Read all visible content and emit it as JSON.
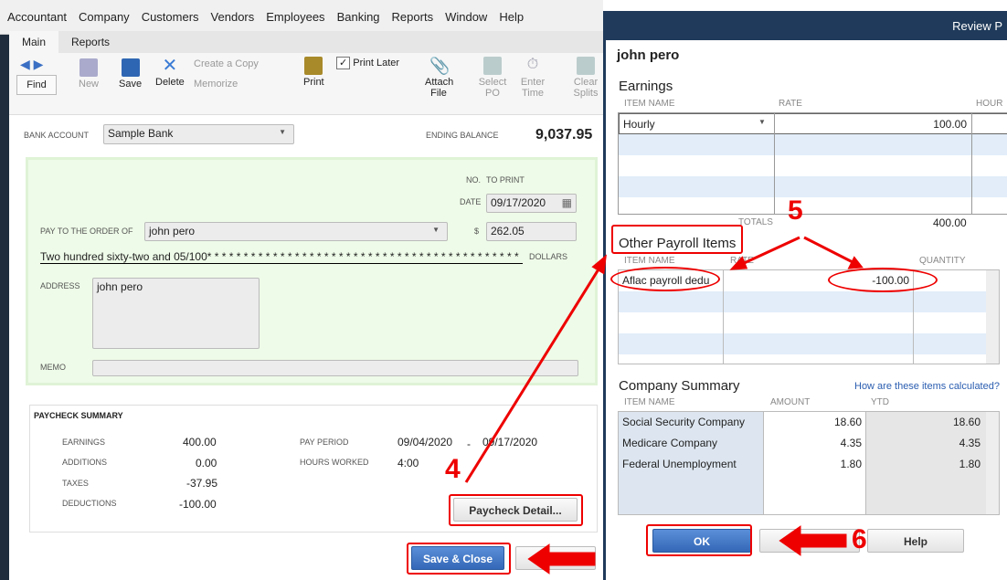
{
  "menu": [
    "Accountant",
    "Company",
    "Customers",
    "Vendors",
    "Employees",
    "Banking",
    "Reports",
    "Window",
    "Help"
  ],
  "tabs": [
    "Main",
    "Reports"
  ],
  "toolbar": {
    "find": "Find",
    "new": "New",
    "save": "Save",
    "delete": "Delete",
    "create_copy": "Create a Copy",
    "memorize": "Memorize",
    "print": "Print",
    "print_later": "Print Later",
    "attach_file": "Attach File",
    "select_po": "Select PO",
    "enter_time": "Enter Time",
    "clear_splits": "Clear Splits"
  },
  "bank": {
    "label": "BANK ACCOUNT",
    "value": "Sample Bank",
    "ending_label": "ENDING BALANCE",
    "ending": "9,037.95"
  },
  "check": {
    "no_label": "NO.",
    "no_value": "TO PRINT",
    "date_label": "DATE",
    "date": "09/17/2020",
    "pay_label": "PAY TO THE ORDER OF",
    "payee": "john pero",
    "dollar_sign": "$",
    "amount": "262.05",
    "words": "Two hundred sixty-two and 05/100* * * * * * * * * * * * * * * * * * * * * * * * * * * * * * * * * * * * * * * * * * *",
    "dollars": "DOLLARS",
    "address_label": "ADDRESS",
    "address": "john pero",
    "memo_label": "MEMO"
  },
  "summary": {
    "title": "PAYCHECK SUMMARY",
    "earnings_l": "EARNINGS",
    "earnings": "400.00",
    "additions_l": "ADDITIONS",
    "additions": "0.00",
    "taxes_l": "TAXES",
    "taxes": "-37.95",
    "deductions_l": "DEDUCTIONS",
    "deductions": "-100.00",
    "period_l": "PAY PERIOD",
    "period_from": "09/04/2020",
    "dash": "-",
    "period_to": "09/17/2020",
    "hours_l": "HOURS WORKED",
    "hours": "4:00",
    "detail_btn": "Paycheck Detail..."
  },
  "save_close": "Save & Close",
  "dialog": {
    "title": "Review P",
    "employee": "john pero",
    "earnings": {
      "title": "Earnings",
      "cols": [
        "ITEM NAME",
        "RATE",
        "HOUR"
      ],
      "item": "Hourly",
      "rate": "100.00",
      "totals_label": "TOTALS",
      "total": "400.00"
    },
    "other": {
      "title": "Other Payroll Items",
      "cols": [
        "ITEM NAME",
        "RATE",
        "QUANTITY"
      ],
      "item": "Aflac payroll dedu",
      "rate": "-100.00"
    },
    "company": {
      "title": "Company Summary",
      "link": "How are these items calculated?",
      "cols": [
        "ITEM NAME",
        "AMOUNT",
        "YTD"
      ],
      "rows": [
        {
          "name": "Social Security Company",
          "amount": "18.60",
          "ytd": "18.60"
        },
        {
          "name": "Medicare Company",
          "amount": "4.35",
          "ytd": "4.35"
        },
        {
          "name": "Federal Unemployment",
          "amount": "1.80",
          "ytd": "1.80"
        }
      ]
    },
    "ok": "OK",
    "help": "Help"
  },
  "annotations": {
    "step4": "4",
    "step5": "5",
    "step6": "6"
  }
}
